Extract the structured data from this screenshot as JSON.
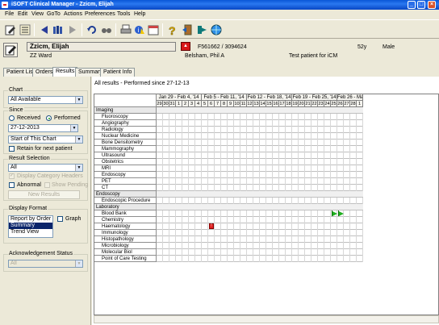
{
  "window": {
    "title": "iSOFT Clinical Manager - Zzicm, Elijah",
    "controls": [
      "_",
      "□",
      "×"
    ]
  },
  "menu": [
    "File",
    "Edit",
    "View",
    "GoTo",
    "Actions",
    "Preferences",
    "Tools",
    "Help"
  ],
  "toolbar": {
    "icons": [
      "edit-chart-icon",
      "patient-list-icon",
      "back-arrow-icon",
      "patient-records-icon",
      "forward-arrow-icon",
      "refresh-icon",
      "search-binoculars-icon",
      "print-icon",
      "info-warning-icon",
      "calendar-icon",
      "help-icon",
      "exit-door-icon",
      "forward-exit-icon",
      "web-icon"
    ]
  },
  "patient": {
    "name": "Zzicm, Elijah",
    "ward": "ZZ Ward",
    "ids": "F561662 / 3094624",
    "doctor": "Belsham, Phil A",
    "age": "52y",
    "sex": "Male",
    "note": "Test patient for iCM",
    "alert_symbol": "▲"
  },
  "tabs": [
    {
      "label": "Patient List",
      "active": false
    },
    {
      "label": "Orders",
      "active": false
    },
    {
      "label": "Results",
      "active": true
    },
    {
      "label": "Summary",
      "active": false
    },
    {
      "label": "Patient Info",
      "active": false
    }
  ],
  "left": {
    "chart_label": "Chart",
    "chart_value": "All Available",
    "since_label": "Since",
    "received_label": "Received",
    "performed_label": "Performed",
    "since_mode": "Performed",
    "since_date": "27-12-2013",
    "start_value": "Start of This Chart",
    "retain_label": "Retain for next patient",
    "result_selection_label": "Result Selection",
    "result_selection_value": "All",
    "display_cat_headers": "Display Category Headers",
    "abnormal_label": "Abnormal",
    "show_pending_label": "Show Pending",
    "new_results_label": "New Results",
    "display_format_label": "Display Format",
    "formats": [
      "Report by Order",
      "Summary",
      "Trend View"
    ],
    "selected_format": "Summary",
    "graph_label": "Graph",
    "ack_status_label": "Acknowledgement Status",
    "ack_status_value": "All"
  },
  "results": {
    "header": "All results - Performed since 27-12-13",
    "weeks": [
      "Jan 29 - Feb 4, '14",
      "Feb 5 - Feb 11, '14",
      "Feb 12 - Feb 18, '14",
      "Feb 19 - Feb 25, '14",
      "Feb 26 - Ma"
    ],
    "days": [
      "29",
      "30",
      "31",
      "1",
      "2",
      "3",
      "4",
      "5",
      "6",
      "7",
      "8",
      "9",
      "10",
      "11",
      "12",
      "13",
      "14",
      "15",
      "16",
      "17",
      "18",
      "19",
      "20",
      "21",
      "22",
      "23",
      "24",
      "25",
      "26",
      "27",
      "28",
      "1"
    ],
    "rows": [
      {
        "label": "Imaging",
        "level": 0
      },
      {
        "label": "Fluoroscopy",
        "level": 1
      },
      {
        "label": "Angiography",
        "level": 1
      },
      {
        "label": "Radiology",
        "level": 1
      },
      {
        "label": "Nuclear Medicine",
        "level": 1
      },
      {
        "label": "Bone Densitometry",
        "level": 1
      },
      {
        "label": "Mammography",
        "level": 1
      },
      {
        "label": "Ultrasound",
        "level": 1
      },
      {
        "label": "Obstetrics",
        "level": 1
      },
      {
        "label": "MRI",
        "level": 1
      },
      {
        "label": "Endoscopy",
        "level": 1
      },
      {
        "label": "PET",
        "level": 1
      },
      {
        "label": "CT",
        "level": 1
      },
      {
        "label": "Endoscopy",
        "level": 0
      },
      {
        "label": "Endoscopic Procedure",
        "level": 1
      },
      {
        "label": "Laboratory",
        "level": 0
      },
      {
        "label": "Blood Bank",
        "level": 1
      },
      {
        "label": "Chemistry",
        "level": 1
      },
      {
        "label": "Haematology",
        "level": 1
      },
      {
        "label": "Immunology",
        "level": 1
      },
      {
        "label": "Histopathology",
        "level": 1
      },
      {
        "label": "Microbiology",
        "level": 1
      },
      {
        "label": "Molecular Biol",
        "level": 1
      },
      {
        "label": "Point of Care Testing",
        "level": 1
      }
    ],
    "markers": [
      {
        "row": "Blood Bank",
        "day": "25",
        "kind": "flag",
        "color": "#1fb01f"
      },
      {
        "row": "Blood Bank",
        "day": "26",
        "kind": "flag",
        "color": "#1fb01f"
      },
      {
        "row": "Haematology",
        "day": "6",
        "kind": "abnormal",
        "color": "#e02020",
        "text": "!"
      }
    ]
  }
}
